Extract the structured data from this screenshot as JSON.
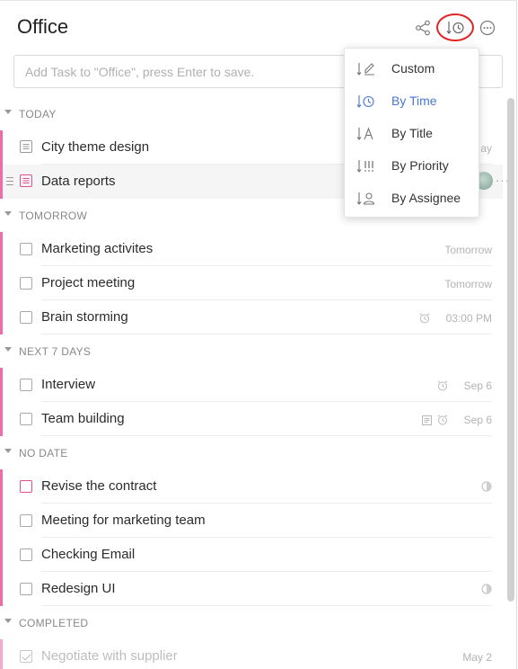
{
  "header": {
    "title": "Office",
    "icons": [
      "share-icon",
      "sort-by-time-icon",
      "more-options-icon"
    ]
  },
  "add_task": {
    "placeholder": "Add Task to \"Office\", press Enter to save."
  },
  "sort_menu": {
    "items": [
      {
        "label": "Custom",
        "icon": "custom-sort-icon",
        "active": false
      },
      {
        "label": "By Time",
        "icon": "time-sort-icon",
        "active": true
      },
      {
        "label": "By Title",
        "icon": "title-sort-icon",
        "active": false
      },
      {
        "label": "By Priority",
        "icon": "priority-sort-icon",
        "active": false
      },
      {
        "label": "By Assignee",
        "icon": "assignee-sort-icon",
        "active": false
      }
    ],
    "active_color": "#4a78d0"
  },
  "sections": {
    "today": {
      "label": "TODAY",
      "tasks": [
        {
          "name": "City theme design",
          "date": "ay"
        },
        {
          "name": "Data reports",
          "date": ""
        }
      ]
    },
    "tomorrow": {
      "label": "TOMORROW",
      "tasks": [
        {
          "name": "Marketing activites",
          "date": "Tomorrow"
        },
        {
          "name": "Project meeting",
          "date": "Tomorrow"
        },
        {
          "name": "Brain storming",
          "date": "03:00 PM"
        }
      ]
    },
    "next7": {
      "label": "NEXT 7 DAYS",
      "tasks": [
        {
          "name": "Interview",
          "date": "Sep 6"
        },
        {
          "name": "Team building",
          "date": "Sep 6"
        }
      ]
    },
    "nodate": {
      "label": "NO DATE",
      "tasks": [
        {
          "name": "Revise the contract",
          "date": ""
        },
        {
          "name": "Meeting for marketing team",
          "date": ""
        },
        {
          "name": "Checking Email",
          "date": ""
        },
        {
          "name": "Redesign UI",
          "date": ""
        }
      ]
    },
    "completed": {
      "label": "COMPLETED",
      "tasks": [
        {
          "name": "Negotiate with supplier",
          "date": "May 2"
        }
      ]
    }
  },
  "colors": {
    "priority_bar": "#f06ca8",
    "highlight_ring": "#e02424"
  }
}
